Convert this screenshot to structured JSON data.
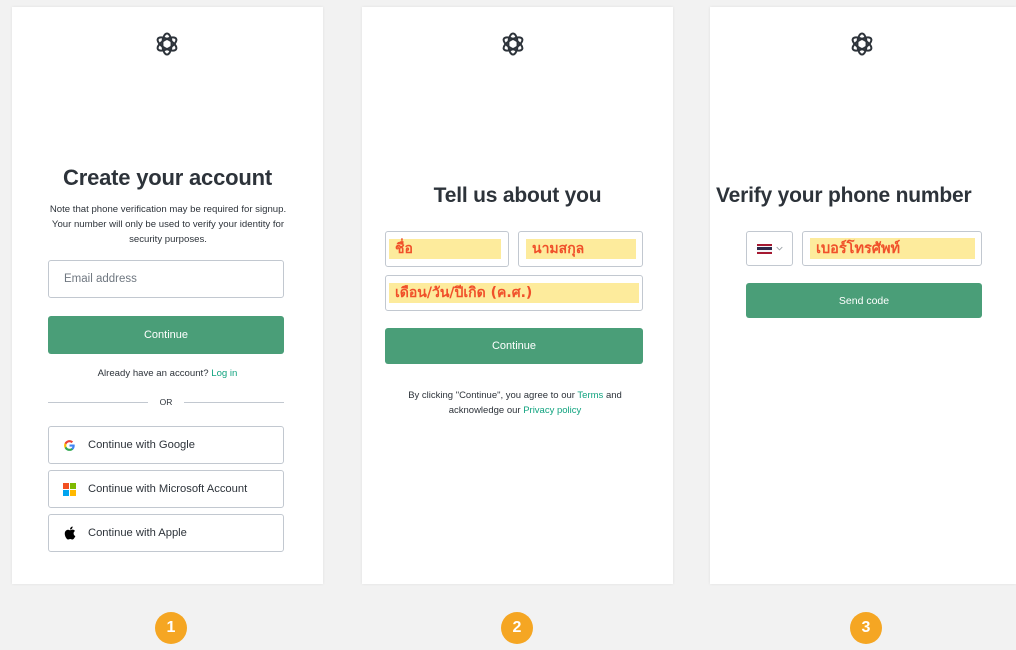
{
  "panel1": {
    "title": "Create your account",
    "note": "Note that phone verification may be required for signup. Your number will only be used to verify your identity for security purposes.",
    "email_placeholder": "Email address",
    "continue_label": "Continue",
    "already_text": "Already have an account?",
    "login_link": "Log in",
    "or_label": "OR",
    "google_label": "Continue with Google",
    "microsoft_label": "Continue with Microsoft Account",
    "apple_label": "Continue with Apple"
  },
  "panel2": {
    "title": "Tell us about you",
    "first_name_label": "ชื่อ",
    "last_name_label": "นามสกุล",
    "birthday_label": "เดือน/วัน/ปีเกิด (ค.ศ.)",
    "continue_label": "Continue",
    "terms_prefix": "By clicking \"Continue\", you agree to our",
    "terms_link": "Terms",
    "terms_and": "and acknowledge our",
    "privacy_link": "Privacy policy"
  },
  "panel3": {
    "title": "Verify your phone number",
    "phone_label": "เบอร์โทรศัพท์",
    "send_code_label": "Send code"
  },
  "steps": [
    "1",
    "2",
    "3"
  ],
  "colors": {
    "primary_button": "#4a9e78",
    "link": "#10a37f",
    "highlight_bg": "#fdeb9c",
    "highlight_text": "#f0502a",
    "step_badge": "#f5a623"
  },
  "icons": [
    "openai-logo-icon",
    "google-icon",
    "microsoft-icon",
    "apple-icon",
    "thailand-flag-icon",
    "chevron-down-icon"
  ]
}
